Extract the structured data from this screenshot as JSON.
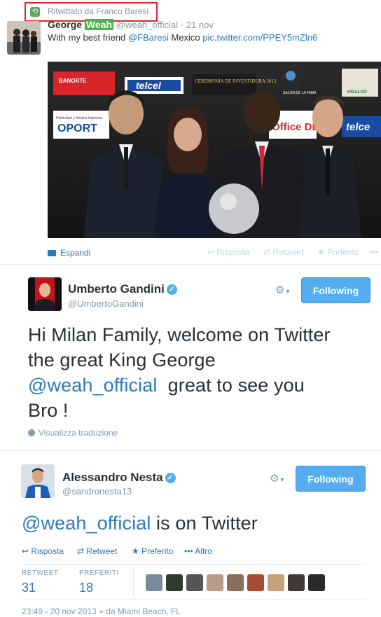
{
  "tweet1": {
    "retweet_label": "Ritwittato da Franco Baresi",
    "name_prefix": "George ",
    "name_highlight": "Weah",
    "handle": "@weah_official",
    "time": "· 21 nov",
    "text_before": "With my best friend ",
    "mention": "@FBaresi",
    "text_middle": " Mexico ",
    "link": "pic.twitter.com/PPEY5mZln6",
    "expand": "Espandi",
    "reply": "Risposta",
    "retweet": "Retweet",
    "favorite": "Preferito",
    "more": "•••",
    "photo_banners": [
      "BANORTE",
      "telcel",
      "CEREMONIA DE INVESTIDURA 2013",
      "SALON DE LA FAMA",
      "HIDALGO",
      "Publicidad y Medios Impresos",
      "OPORT",
      "Office DEPOT",
      "telce"
    ]
  },
  "tweet2": {
    "name": "Umberto Gandini",
    "handle": "@UmbertoGandini",
    "follow": "Following",
    "line1": "Hi Milan Family, welcome on Twitter",
    "line2": "the great King George",
    "mention": "@weah_official",
    "line3_rest": "  great to see you",
    "line4": "Bro !",
    "translate": "Visualizza traduzione"
  },
  "tweet3": {
    "name": "Alessandro Nesta",
    "handle": "@sandronesta13",
    "follow": "Following",
    "mention": "@weah_official",
    "text_rest": " is on Twitter",
    "reply": "Risposta",
    "retweet": "Retweet",
    "favorite": "Preferito",
    "more": "Altro",
    "retweets_label": "RETWEET",
    "retweets": "31",
    "favorites_label": "PREFERITI",
    "favorites": "18",
    "timestamp": "23:49 - 20 nov 2013",
    "location": "da Miami Beach, FL"
  },
  "colors": {
    "accent": "#55acee",
    "link": "#2b7bb9",
    "highlight_box": "#d9262b",
    "name_highlight": "#4caf50"
  }
}
